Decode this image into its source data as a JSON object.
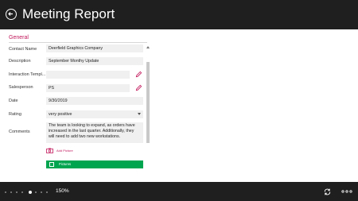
{
  "header": {
    "title": "Meeting Report"
  },
  "section": {
    "title": "General"
  },
  "fields": {
    "contact_name": {
      "label": "Contact Name",
      "value": "Deerfield Graphics Company"
    },
    "description": {
      "label": "Description",
      "value": "September Monthy Update"
    },
    "interaction_template": {
      "label": "Interaction Templ...",
      "value": ""
    },
    "salesperson": {
      "label": "Salesperson",
      "value": "PS"
    },
    "date": {
      "label": "Date",
      "value": "9/30/2019"
    },
    "rating": {
      "label": "Rating",
      "value": "very positive"
    },
    "comments": {
      "label": "Comments",
      "value": "The team is looking to expand, as orders have increased in the last quarter. Additionally, they will need to add two new workstations."
    }
  },
  "add_picture": {
    "label": "Add Picture"
  },
  "pictures": {
    "label": "Pictures"
  },
  "footer": {
    "zoom": "150%"
  },
  "colors": {
    "accent": "#c2185b",
    "green": "#00a550",
    "bar": "#1f1f1f"
  },
  "icons": {
    "back": "back-arrow-icon",
    "edit": "pencil-icon",
    "sync": "sync-icon",
    "more": "more-icon"
  }
}
